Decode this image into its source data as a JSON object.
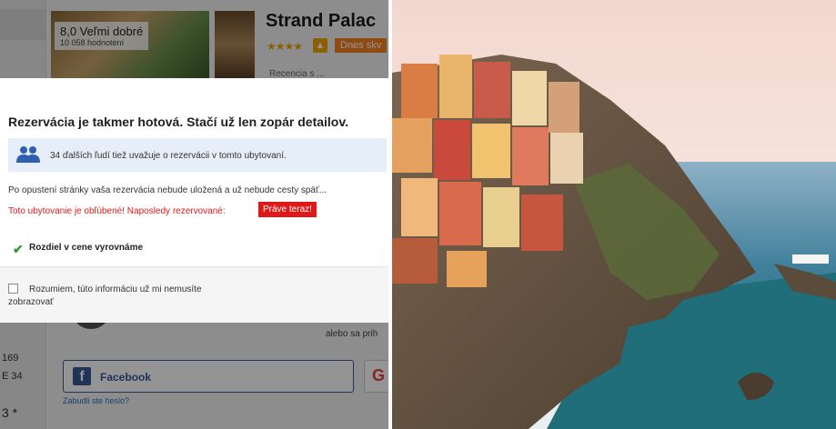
{
  "left_panel": {
    "background_page": {
      "rating_score": "8,0 Veľmi dobré",
      "rating_count": "10 058 hodnotení",
      "hotel_name": "Strand Palac",
      "stars": "★★★★",
      "thumbs_icon": "thumbs-up-icon",
      "deal_text": "Dnes skv",
      "review_text": "Recencia s ...",
      "side_numbers": [
        "169",
        "E 34",
        "3 *"
      ],
      "login_alt_text": "alebo sa prih",
      "facebook_label": "Facebook",
      "google_icon": "google-icon",
      "forgot_password": "Zabudli ste heslo?"
    },
    "modal": {
      "title": "Rezervácia je takmer hotová. Stačí už len zopár detailov.",
      "info_icon": "people-icon",
      "info_text": "34 ďalších ľudí tiež uvažuje o rezervácii v tomto ubytovaní.",
      "warning_text": "Po opustení stránky vaša rezervácia nebude uložená a už nebude cesty späť...",
      "popular_text": "Toto ubytovanie je obľúbené! Naposledy rezervované:",
      "popular_badge": "Práve teraz!",
      "price_match_icon": "checkmark-icon",
      "price_match_text": "Rozdiel v cene vyrovnáme",
      "dismiss_text": "Rozumiem, túto informáciu už mi nemusíte zobrazovať",
      "dismiss_checked": false
    }
  },
  "right_panel": {
    "photo_subject": "coastal-village-photo"
  },
  "colors": {
    "alert_red": "#e01818",
    "info_bg": "#e6eefa",
    "check_green": "#2f9e2f",
    "facebook_blue": "#3b5998",
    "deal_orange": "#f58220"
  }
}
